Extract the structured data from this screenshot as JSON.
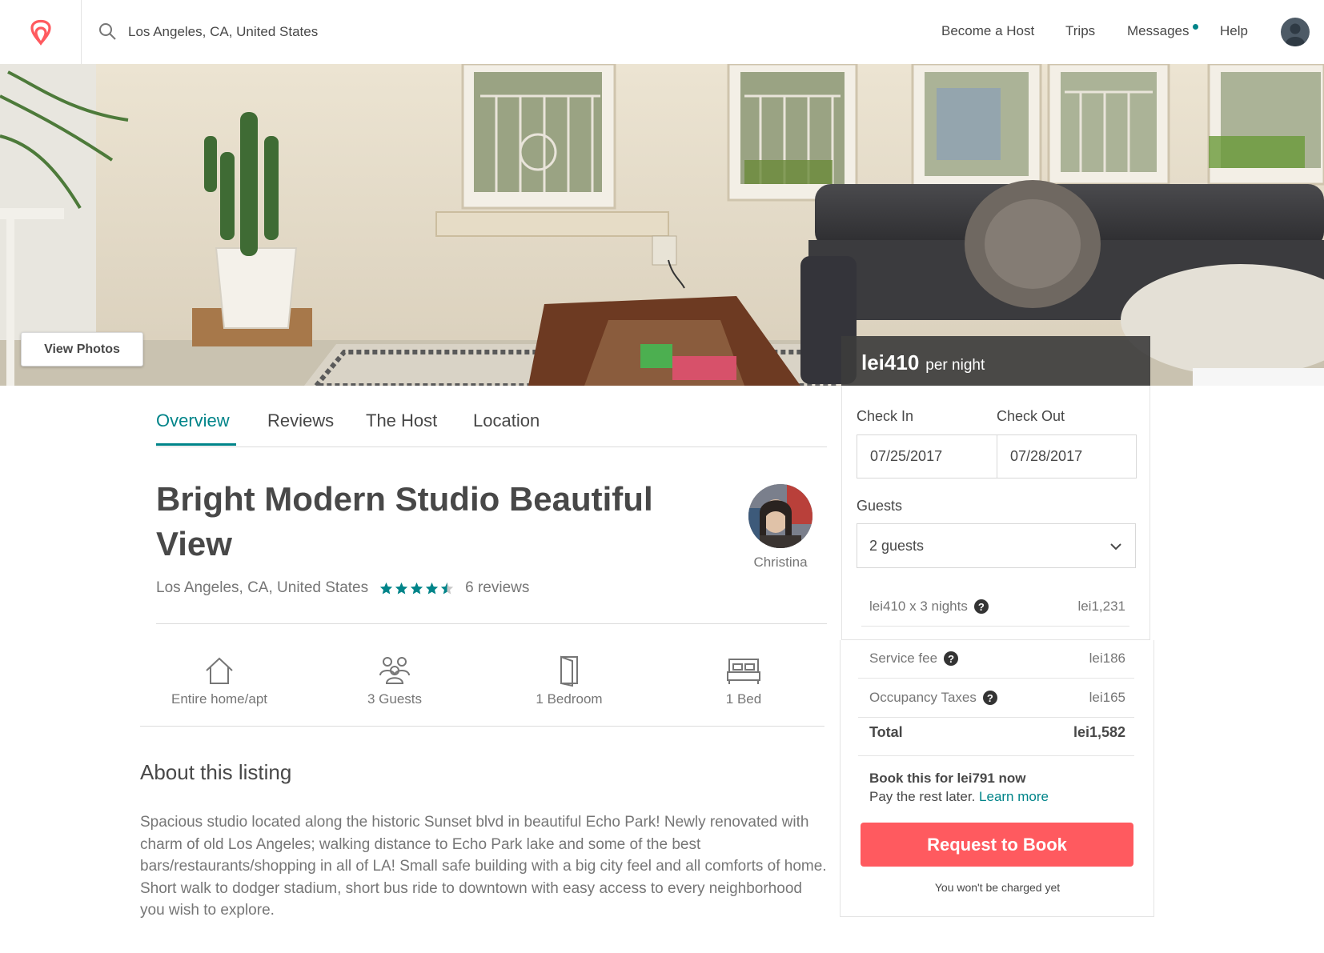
{
  "header": {
    "search_value": "Los Angeles, CA, United States",
    "nav": [
      "Become a Host",
      "Trips",
      "Messages",
      "Help"
    ]
  },
  "hero": {
    "view_photos_label": "View Photos"
  },
  "booking": {
    "price": "lei410",
    "price_unit": "per night",
    "check_in_label": "Check In",
    "check_out_label": "Check Out",
    "check_in_value": "07/25/2017",
    "check_out_value": "07/28/2017",
    "guests_label": "Guests",
    "guests_value": "2 guests",
    "nights_label": "lei410 x 3 nights",
    "nights_value": "lei1,231",
    "service_label": "Service fee",
    "service_value": "lei186",
    "taxes_label": "Occupancy Taxes",
    "taxes_value": "lei165",
    "total_label": "Total",
    "total_value": "lei1,582",
    "book_this": "Book this for lei791 now",
    "pay_rest": "Pay the rest later.",
    "learn_more": "Learn more",
    "request_button": "Request to Book",
    "not_charged": "You won't be charged yet"
  },
  "tabs": [
    "Overview",
    "Reviews",
    "The Host",
    "Location"
  ],
  "listing": {
    "title": "Bright Modern Studio Beautiful View",
    "location": "Los Angeles, CA, United States",
    "rating": 4.5,
    "reviews": "6 reviews",
    "host_name": "Christina"
  },
  "amenities": [
    "Entire home/apt",
    "3 Guests",
    "1 Bedroom",
    "1 Bed"
  ],
  "about": {
    "title": "About this listing",
    "text": "Spacious studio located along the historic Sunset blvd in beautiful Echo Park! Newly renovated with charm of old Los Angeles; walking distance to Echo Park lake and some of the best bars/restaurants/shopping in all of LA! Small safe building with a big city feel and all comforts of home. Short walk to dodger stadium, short bus ride to downtown with easy access to every neighborhood you wish to explore."
  },
  "colors": {
    "brand": "#ff5a5f",
    "accent": "#008489",
    "text": "#484848",
    "muted": "#767676"
  }
}
